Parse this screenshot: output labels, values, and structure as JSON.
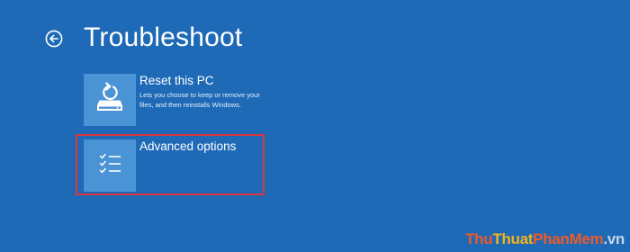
{
  "colors": {
    "background": "#1e6ab7",
    "tile": "#4a93d4",
    "highlight": "#d9363e"
  },
  "header": {
    "back_icon": "back-arrow-circle-icon",
    "title": "Troubleshoot"
  },
  "options": [
    {
      "icon": "reset-pc-icon",
      "title": "Reset this PC",
      "description": "Lets you choose to keep or remove your files, and then reinstalls Windows."
    },
    {
      "icon": "checklist-icon",
      "title": "Advanced options",
      "description": ""
    }
  ],
  "watermark": {
    "part1": "Thu",
    "part2": "Thuat",
    "part3": "PhanMem",
    "part4": ".vn"
  }
}
